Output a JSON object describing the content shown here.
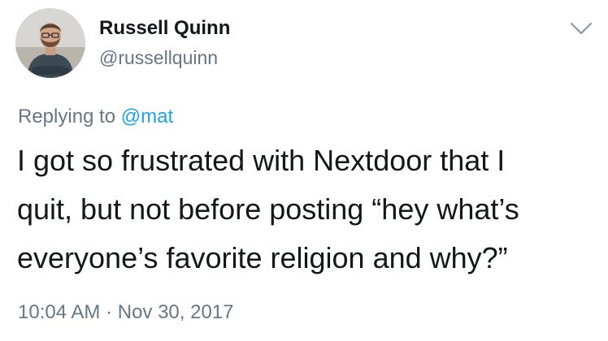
{
  "author": {
    "display_name": "Russell Quinn",
    "handle": "@russellquinn",
    "avatar_icon": "user-avatar-photo"
  },
  "menu_icon": "chevron-down-icon",
  "reply_context": {
    "prefix": "Replying to ",
    "mention": "@mat"
  },
  "tweet": {
    "text": "I got so frustrated with Nextdoor that I\nquit, but not before posting “hey what’s\neveryone’s favorite religion and why?”"
  },
  "timestamp": {
    "time": "10:04 AM",
    "separator": " · ",
    "date": "Nov 30, 2017"
  },
  "colors": {
    "text_primary": "#14171a",
    "text_secondary": "#657786",
    "link": "#1da1f2",
    "background": "#ffffff"
  }
}
